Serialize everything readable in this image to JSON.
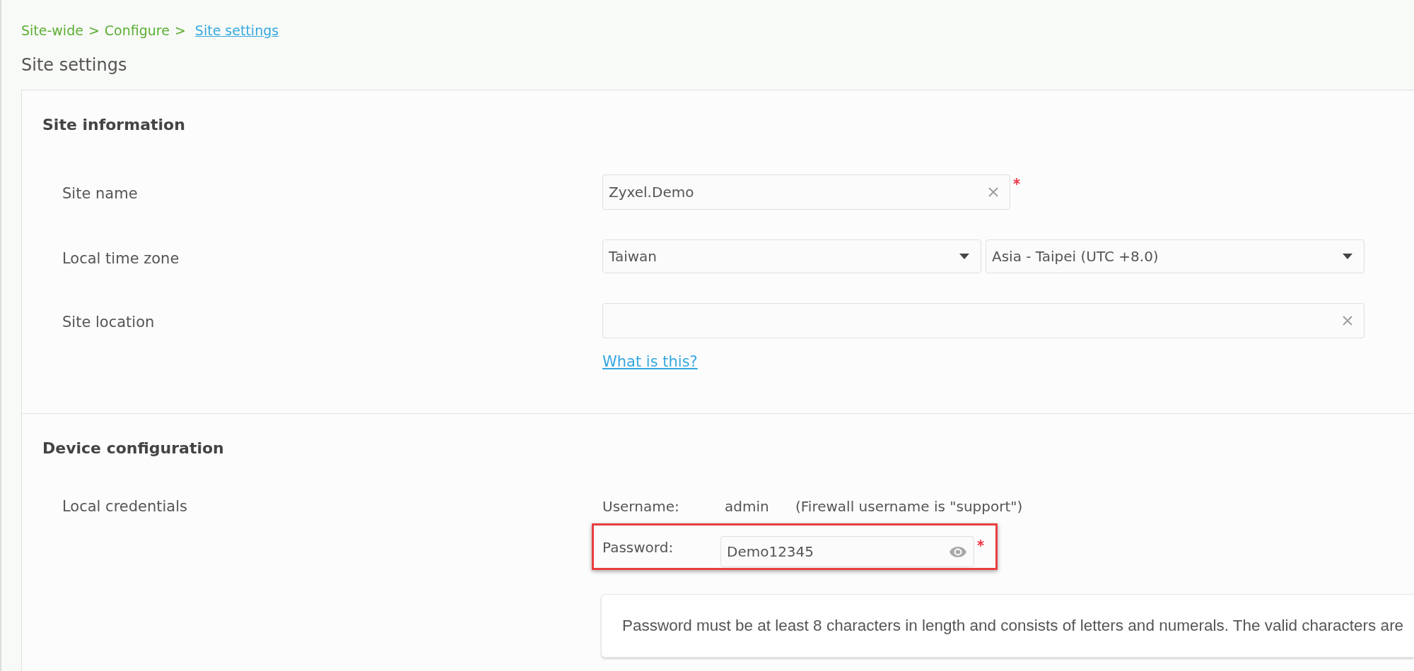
{
  "breadcrumb": {
    "items": [
      {
        "label": "Site-wide",
        "current": false,
        "separator": ">"
      },
      {
        "label": "Configure",
        "current": false,
        "separator": ">"
      },
      {
        "label": "Site settings",
        "current": true
      }
    ]
  },
  "page_title": "Site settings",
  "sections": [
    {
      "title": "Site information",
      "rows": [
        {
          "label": "Site name",
          "controls": [
            {
              "kind": "input",
              "value": "Zyxel.Demo",
              "clearable": true,
              "required": true
            }
          ]
        },
        {
          "label": "Local time zone",
          "controls": [
            {
              "kind": "select",
              "value": "Taiwan"
            },
            {
              "kind": "select",
              "value": "Asia - Taipei (UTC +8.0)"
            }
          ]
        },
        {
          "label": "Site location",
          "controls": [
            {
              "kind": "input",
              "clearable": true,
              "required": false
            },
            {
              "kind": "link",
              "label": "What is this?"
            }
          ]
        }
      ]
    },
    {
      "title": "Device configuration",
      "rows": [
        {
          "label": "Local credentials",
          "controls": [
            {
              "kind": "credentials",
              "username_label": "Username:",
              "username": "admin",
              "username_note": "(Firewall username is \"support\")",
              "password_label": "Password:",
              "password": "Demo12345",
              "required": true,
              "highlighted": true
            },
            {
              "kind": "note",
              "text": "Password must be at least 8 characters in length and consists of letters and numerals. The valid characters are"
            }
          ]
        }
      ]
    }
  ]
}
